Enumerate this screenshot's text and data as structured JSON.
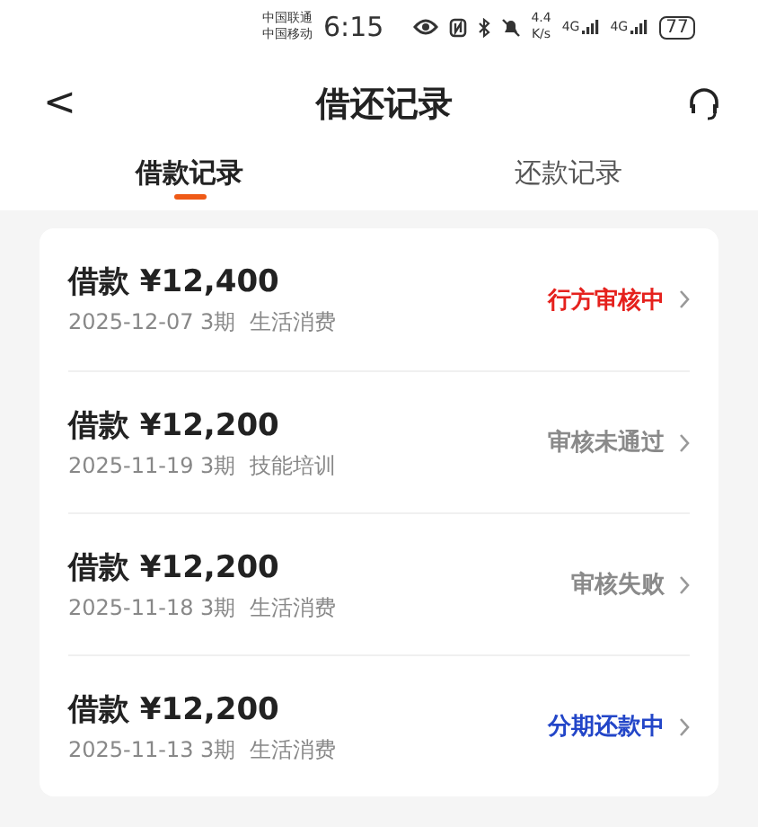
{
  "status_bar": {
    "carriers": [
      "中国联通",
      "中国移动"
    ],
    "time": "6:15",
    "net_speed": [
      "4.4",
      "K/s"
    ],
    "signals": [
      "4G",
      "4G"
    ],
    "battery": "77"
  },
  "header": {
    "back": "<",
    "title": "借还记录"
  },
  "tabs": [
    {
      "label": "借款记录",
      "selected": true
    },
    {
      "label": "还款记录",
      "selected": false
    }
  ],
  "records": [
    {
      "title": "借款 ¥12,400",
      "meta": "2025-12-07 3期  生活消费",
      "status": "行方审核中",
      "color": "#e5211d"
    },
    {
      "title": "借款 ¥12,200",
      "meta": "2025-11-19 3期  技能培训",
      "status": "审核未通过",
      "color": "#8a8a8a"
    },
    {
      "title": "借款 ¥12,200",
      "meta": "2025-11-18 3期  生活消费",
      "status": "审核失败",
      "color": "#8a8a8a"
    },
    {
      "title": "借款 ¥12,200",
      "meta": "2025-11-13 3期  生活消费",
      "status": "分期还款中",
      "color": "#2346c8"
    }
  ]
}
